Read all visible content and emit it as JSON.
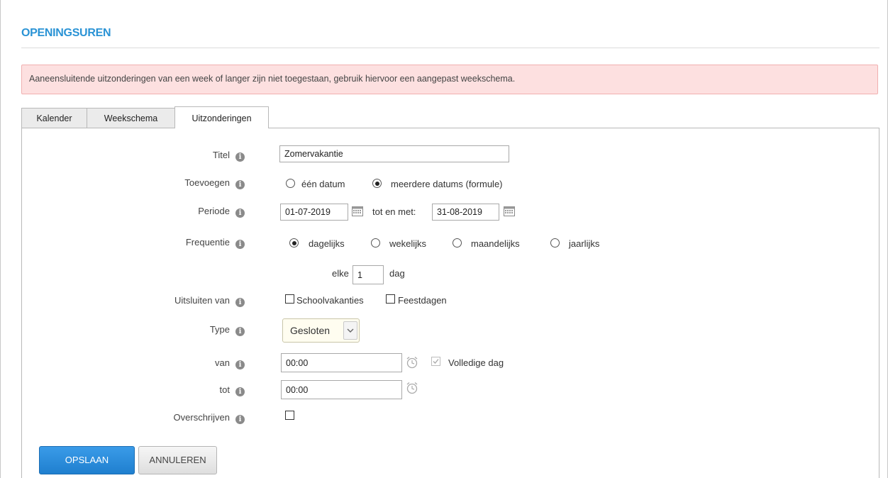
{
  "page": {
    "title": "OPENINGSUREN"
  },
  "alert": {
    "text": "Aaneensluitende uitzonderingen van een week of langer zijn niet toegestaan, gebruik hiervoor een aangepast weekschema."
  },
  "tabs": [
    {
      "label": "Kalender",
      "active": false
    },
    {
      "label": "Weekschema",
      "active": false
    },
    {
      "label": "Uitzonderingen",
      "active": true
    }
  ],
  "form": {
    "titel": {
      "label": "Titel",
      "value": "Zomervakantie"
    },
    "toevoegen": {
      "label": "Toevoegen",
      "options": [
        {
          "label": "één datum",
          "checked": false
        },
        {
          "label": "meerdere datums (formule)",
          "checked": true
        }
      ]
    },
    "periode": {
      "label": "Periode",
      "from": "01-07-2019",
      "to_label": "tot en met:",
      "to": "31-08-2019"
    },
    "frequentie": {
      "label": "Frequentie",
      "options": [
        {
          "label": "dagelijks",
          "checked": true
        },
        {
          "label": "wekelijks",
          "checked": false
        },
        {
          "label": "maandelijks",
          "checked": false
        },
        {
          "label": "jaarlijks",
          "checked": false
        }
      ],
      "every_label": "elke",
      "every_value": "1",
      "unit_label": "dag"
    },
    "uitsluiten": {
      "label": "Uitsluiten van",
      "options": [
        {
          "label": "Schoolvakanties",
          "checked": false
        },
        {
          "label": "Feestdagen",
          "checked": false
        }
      ]
    },
    "type": {
      "label": "Type",
      "selected": "Gesloten"
    },
    "van": {
      "label": "van",
      "value": "00:00",
      "full_day_label": "Volledige dag",
      "full_day_checked": true
    },
    "tot": {
      "label": "tot",
      "value": "00:00"
    },
    "overschrijven": {
      "label": "Overschrijven",
      "checked": false
    }
  },
  "buttons": {
    "save": "OPSLAAN",
    "cancel": "ANNULEREN"
  },
  "colors": {
    "accent": "#2a93d5",
    "alert_bg": "#fde0e0",
    "primary_button": "#2286d6"
  }
}
